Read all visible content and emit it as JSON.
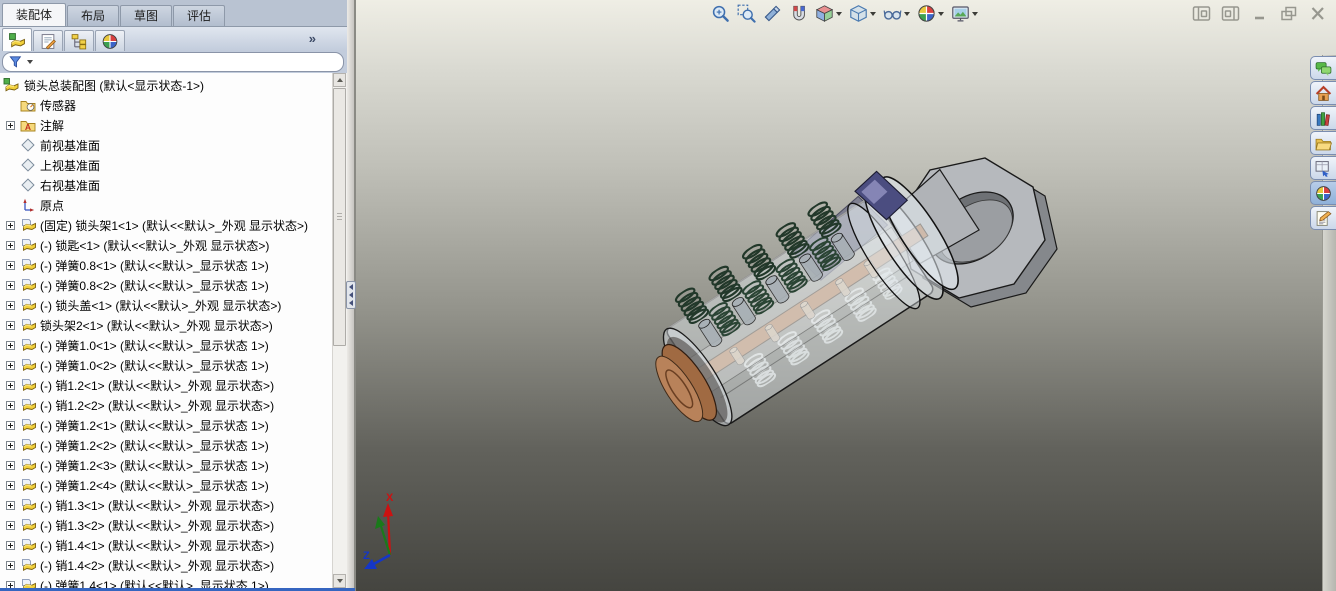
{
  "command_tabs": {
    "items": [
      {
        "label": "装配体",
        "active": true
      },
      {
        "label": "布局"
      },
      {
        "label": "草图"
      },
      {
        "label": "评估"
      }
    ]
  },
  "manager_tabs": {
    "overflow_label": "»",
    "tabs": [
      {
        "icon": "featuremanager-tree",
        "sym": "assembly",
        "active": true
      },
      {
        "icon": "propertymanager",
        "sym": "propmgr"
      },
      {
        "icon": "configurationmanager",
        "sym": "cfgmgr"
      },
      {
        "icon": "displaymanager",
        "sym": "colorball"
      }
    ]
  },
  "filter_bar": {
    "icon": "filter"
  },
  "feature_tree": {
    "root": {
      "icon": "assembly",
      "label": "锁头总装配图 (默认<显示状态-1>)"
    },
    "items": [
      {
        "icon": "sensors-folder",
        "label": "传感器",
        "expand": false
      },
      {
        "icon": "annotations-folder",
        "label": "注解",
        "expand": true
      },
      {
        "icon": "plane",
        "label": "前视基准面",
        "expand": false
      },
      {
        "icon": "plane",
        "label": "上视基准面",
        "expand": false
      },
      {
        "icon": "plane",
        "label": "右视基准面",
        "expand": false
      },
      {
        "icon": "origin",
        "label": "原点",
        "expand": false
      },
      {
        "icon": "component",
        "label": "(固定) 锁头架1<1> (默认<<默认>_外观 显示状态>)",
        "expand": true
      },
      {
        "icon": "component",
        "label": "(-) 锁匙<1> (默认<<默认>_外观 显示状态>)",
        "expand": true
      },
      {
        "icon": "component",
        "label": "(-) 弹簧0.8<1> (默认<<默认>_显示状态 1>)",
        "expand": true
      },
      {
        "icon": "component",
        "label": "(-) 弹簧0.8<2> (默认<<默认>_显示状态 1>)",
        "expand": true
      },
      {
        "icon": "component",
        "label": "(-) 锁头盖<1> (默认<<默认>_外观 显示状态>)",
        "expand": true
      },
      {
        "icon": "component",
        "label": "锁头架2<1> (默认<<默认>_外观 显示状态>)",
        "expand": true
      },
      {
        "icon": "component",
        "label": "(-) 弹簧1.0<1> (默认<<默认>_显示状态 1>)",
        "expand": true
      },
      {
        "icon": "component",
        "label": "(-) 弹簧1.0<2> (默认<<默认>_显示状态 1>)",
        "expand": true
      },
      {
        "icon": "component",
        "label": "(-) 销1.2<1> (默认<<默认>_外观 显示状态>)",
        "expand": true
      },
      {
        "icon": "component",
        "label": "(-) 销1.2<2> (默认<<默认>_外观 显示状态>)",
        "expand": true
      },
      {
        "icon": "component",
        "label": "(-) 弹簧1.2<1> (默认<<默认>_显示状态 1>)",
        "expand": true
      },
      {
        "icon": "component",
        "label": "(-) 弹簧1.2<2> (默认<<默认>_显示状态 1>)",
        "expand": true
      },
      {
        "icon": "component",
        "label": "(-) 弹簧1.2<3> (默认<<默认>_显示状态 1>)",
        "expand": true
      },
      {
        "icon": "component",
        "label": "(-) 弹簧1.2<4> (默认<<默认>_显示状态 1>)",
        "expand": true
      },
      {
        "icon": "component",
        "label": "(-) 销1.3<1> (默认<<默认>_外观 显示状态>)",
        "expand": true
      },
      {
        "icon": "component",
        "label": "(-) 销1.3<2> (默认<<默认>_外观 显示状态>)",
        "expand": true
      },
      {
        "icon": "component",
        "label": "(-) 销1.4<1> (默认<<默认>_外观 显示状态>)",
        "expand": true
      },
      {
        "icon": "component",
        "label": "(-) 销1.4<2> (默认<<默认>_外观 显示状态>)",
        "expand": true
      },
      {
        "icon": "component",
        "label": "(-) 弹簧1.4<1> (默认<<默认>_显示状态 1>)",
        "expand": true
      }
    ]
  },
  "headsup_toolbar": {
    "buttons": [
      {
        "icon": "zoom-to-fit",
        "sym": "zoomfit"
      },
      {
        "icon": "zoom-to-area",
        "sym": "zoomarea"
      },
      {
        "icon": "previous-view",
        "sym": "prevview"
      },
      {
        "icon": "section-view",
        "sym": "section"
      },
      {
        "icon": "view-orientation",
        "sym": "orientcube",
        "caret": true
      },
      {
        "icon": "display-style",
        "sym": "stylecube",
        "caret": true
      },
      {
        "icon": "hide-show-items",
        "sym": "glasses",
        "caret": true
      },
      {
        "icon": "edit-appearance",
        "sym": "colorball",
        "caret": true
      },
      {
        "icon": "apply-scene",
        "sym": "scene",
        "caret": true
      }
    ]
  },
  "window_controls": {
    "buttons": [
      {
        "icon": "dock-pane-left",
        "sym": "dockl"
      },
      {
        "icon": "dock-pane-right",
        "sym": "dockr"
      },
      {
        "icon": "minimize",
        "sym": "minimize"
      },
      {
        "icon": "restore",
        "sym": "restore"
      },
      {
        "icon": "close",
        "sym": "close"
      }
    ]
  },
  "task_pane": {
    "tabs": [
      {
        "icon": "solidworks-forum",
        "sym": "forum"
      },
      {
        "icon": "solidworks-resources",
        "sym": "home"
      },
      {
        "icon": "design-library",
        "sym": "library"
      },
      {
        "icon": "file-explorer",
        "sym": "folderx"
      },
      {
        "icon": "view-palette",
        "sym": "viewpalette"
      },
      {
        "icon": "appearances-scenes",
        "sym": "colorball",
        "active": true
      },
      {
        "icon": "custom-properties",
        "sym": "customprops"
      }
    ]
  },
  "viewport": {
    "background": {
      "top": "#efeee5",
      "bottom": "#454540"
    },
    "triad": {
      "x_label": "X",
      "z_label": "Z",
      "x_color": "#cc1111",
      "y_color": "#1a7a1a",
      "z_color": "#1436c8"
    },
    "model": {
      "name": "锁头总装配图",
      "colors": {
        "housing": "#e4eaf0",
        "key": "#b0784e",
        "front_plug": "#a06a42",
        "springs_dark": "#22382a",
        "springs_light": "#e4e8e6",
        "pins_gray": "#a8b0b6",
        "pins_copper": "#c8b49c",
        "cover_purple": "#4b4d80",
        "key_head": "#b6b9bd"
      }
    }
  },
  "splitter": {
    "collapse_icon": "collapse-left"
  }
}
